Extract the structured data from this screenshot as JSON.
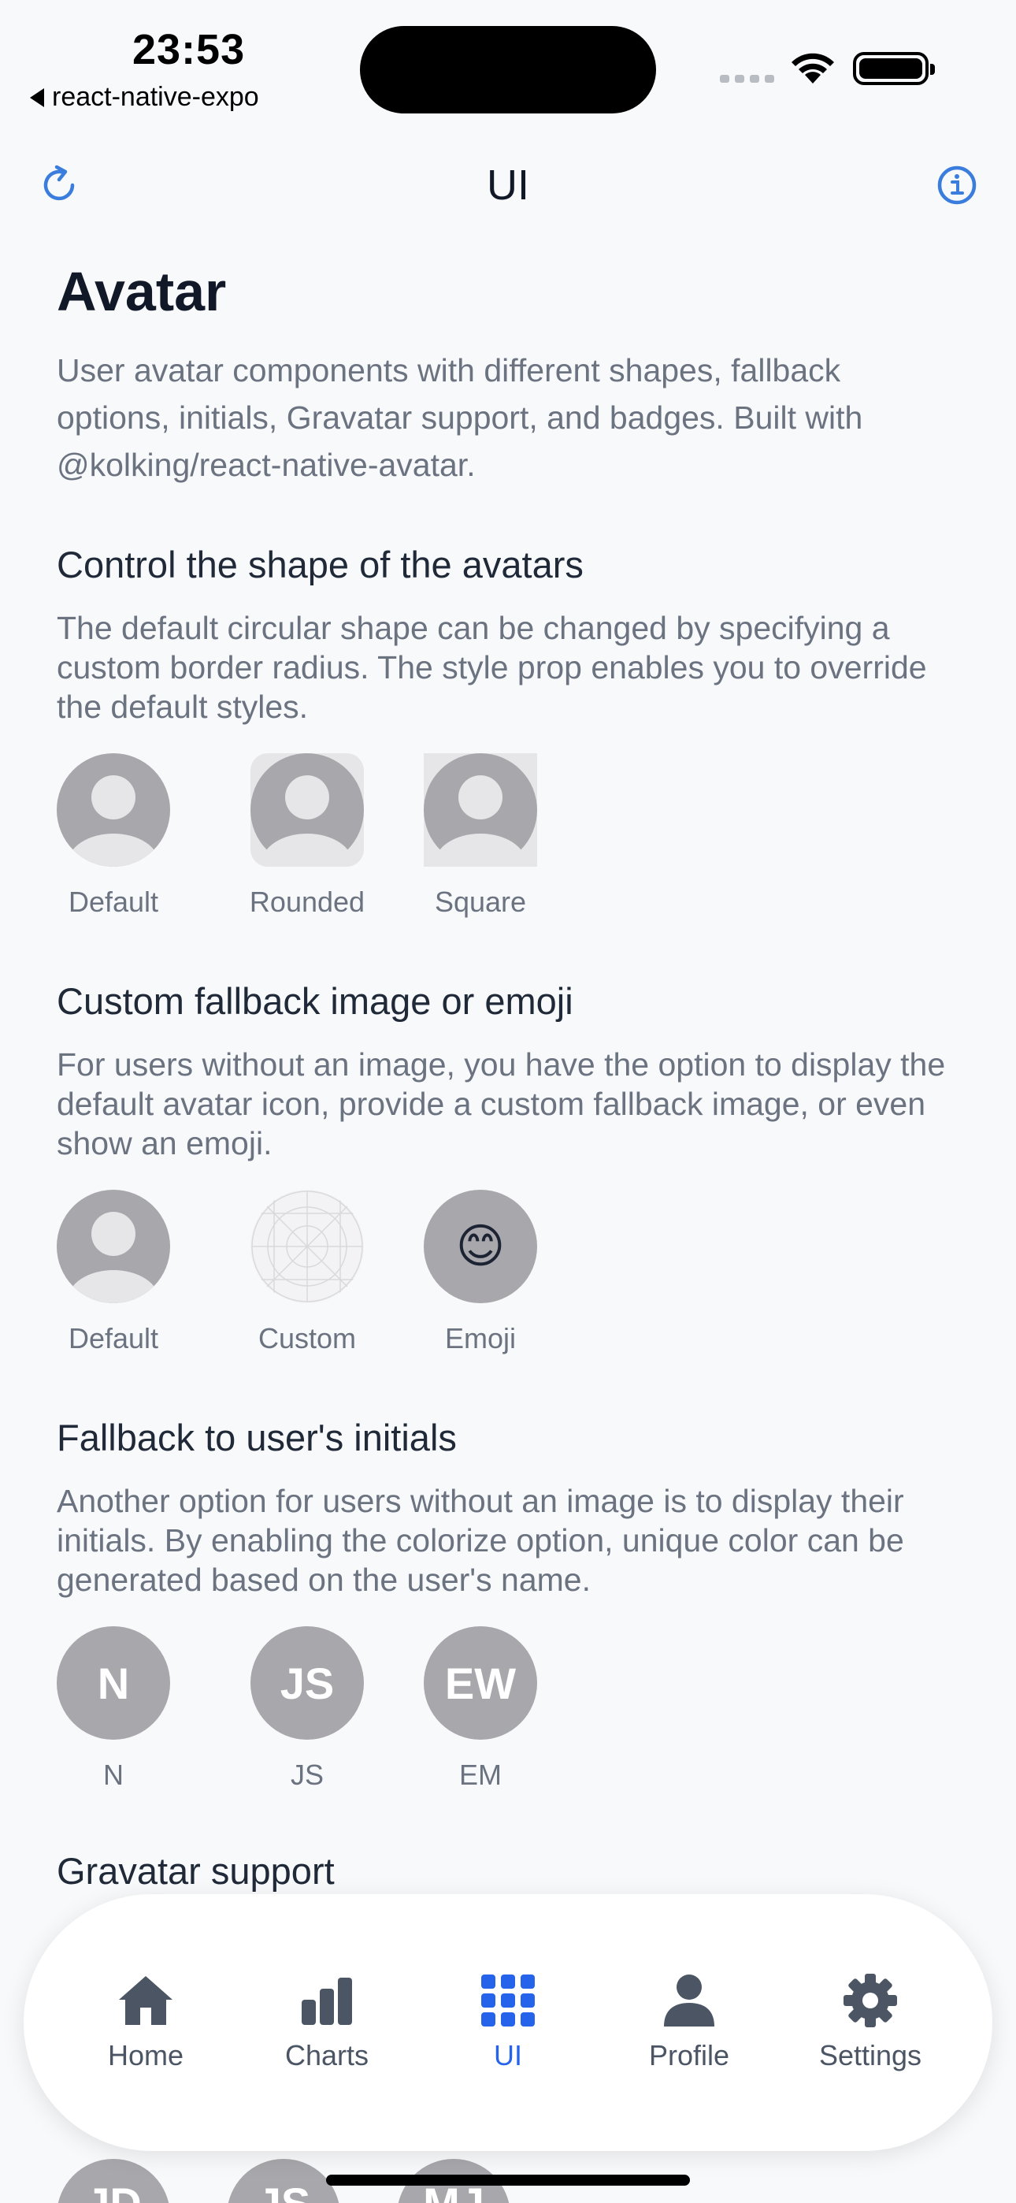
{
  "status_bar": {
    "time": "23:53",
    "back_app": "react-native-expo"
  },
  "header": {
    "title": "UI",
    "left_icon": "refresh-icon",
    "right_icon": "info-icon"
  },
  "page": {
    "title": "Avatar",
    "intro": "User avatar components with different shapes, fallback options, initials, Gravatar support, and badges. Built with @kolking/react-native-avatar."
  },
  "sections": [
    {
      "title": "Control the shape of the avatars",
      "desc": "The default circular shape can be changed by specifying a custom border radius. The style prop enables you to override the default styles.",
      "items": [
        {
          "label": "Default"
        },
        {
          "label": "Rounded"
        },
        {
          "label": "Square"
        }
      ]
    },
    {
      "title": "Custom fallback image or emoji",
      "desc": "For users without an image, you have the option to display the default avatar icon, provide a custom fallback image, or even show an emoji.",
      "items": [
        {
          "label": "Default"
        },
        {
          "label": "Custom"
        },
        {
          "label": "Emoji",
          "emoji": "😊"
        }
      ]
    },
    {
      "title": "Fallback to user's initials",
      "desc": "Another option for users without an image is to display their initials. By enabling the colorize option, unique color can be generated based on the user's name.",
      "items": [
        {
          "initials": "N",
          "label": "N"
        },
        {
          "initials": "JS",
          "label": "JS"
        },
        {
          "initials": "EW",
          "label": "EM"
        }
      ]
    },
    {
      "title": "Gravatar support"
    }
  ],
  "peek_initials": [
    "JD",
    "JS",
    "MJ"
  ],
  "tabbar": {
    "items": [
      {
        "label": "Home",
        "icon": "home-icon",
        "active": false
      },
      {
        "label": "Charts",
        "icon": "bar-chart-icon",
        "active": false
      },
      {
        "label": "UI",
        "icon": "grid-icon",
        "active": true
      },
      {
        "label": "Profile",
        "icon": "person-icon",
        "active": false
      },
      {
        "label": "Settings",
        "icon": "gear-icon",
        "active": false
      }
    ]
  },
  "colors": {
    "accent": "#2563eb",
    "avatar_bg": "#a8a7ac",
    "muted_text": "#6b7280"
  }
}
